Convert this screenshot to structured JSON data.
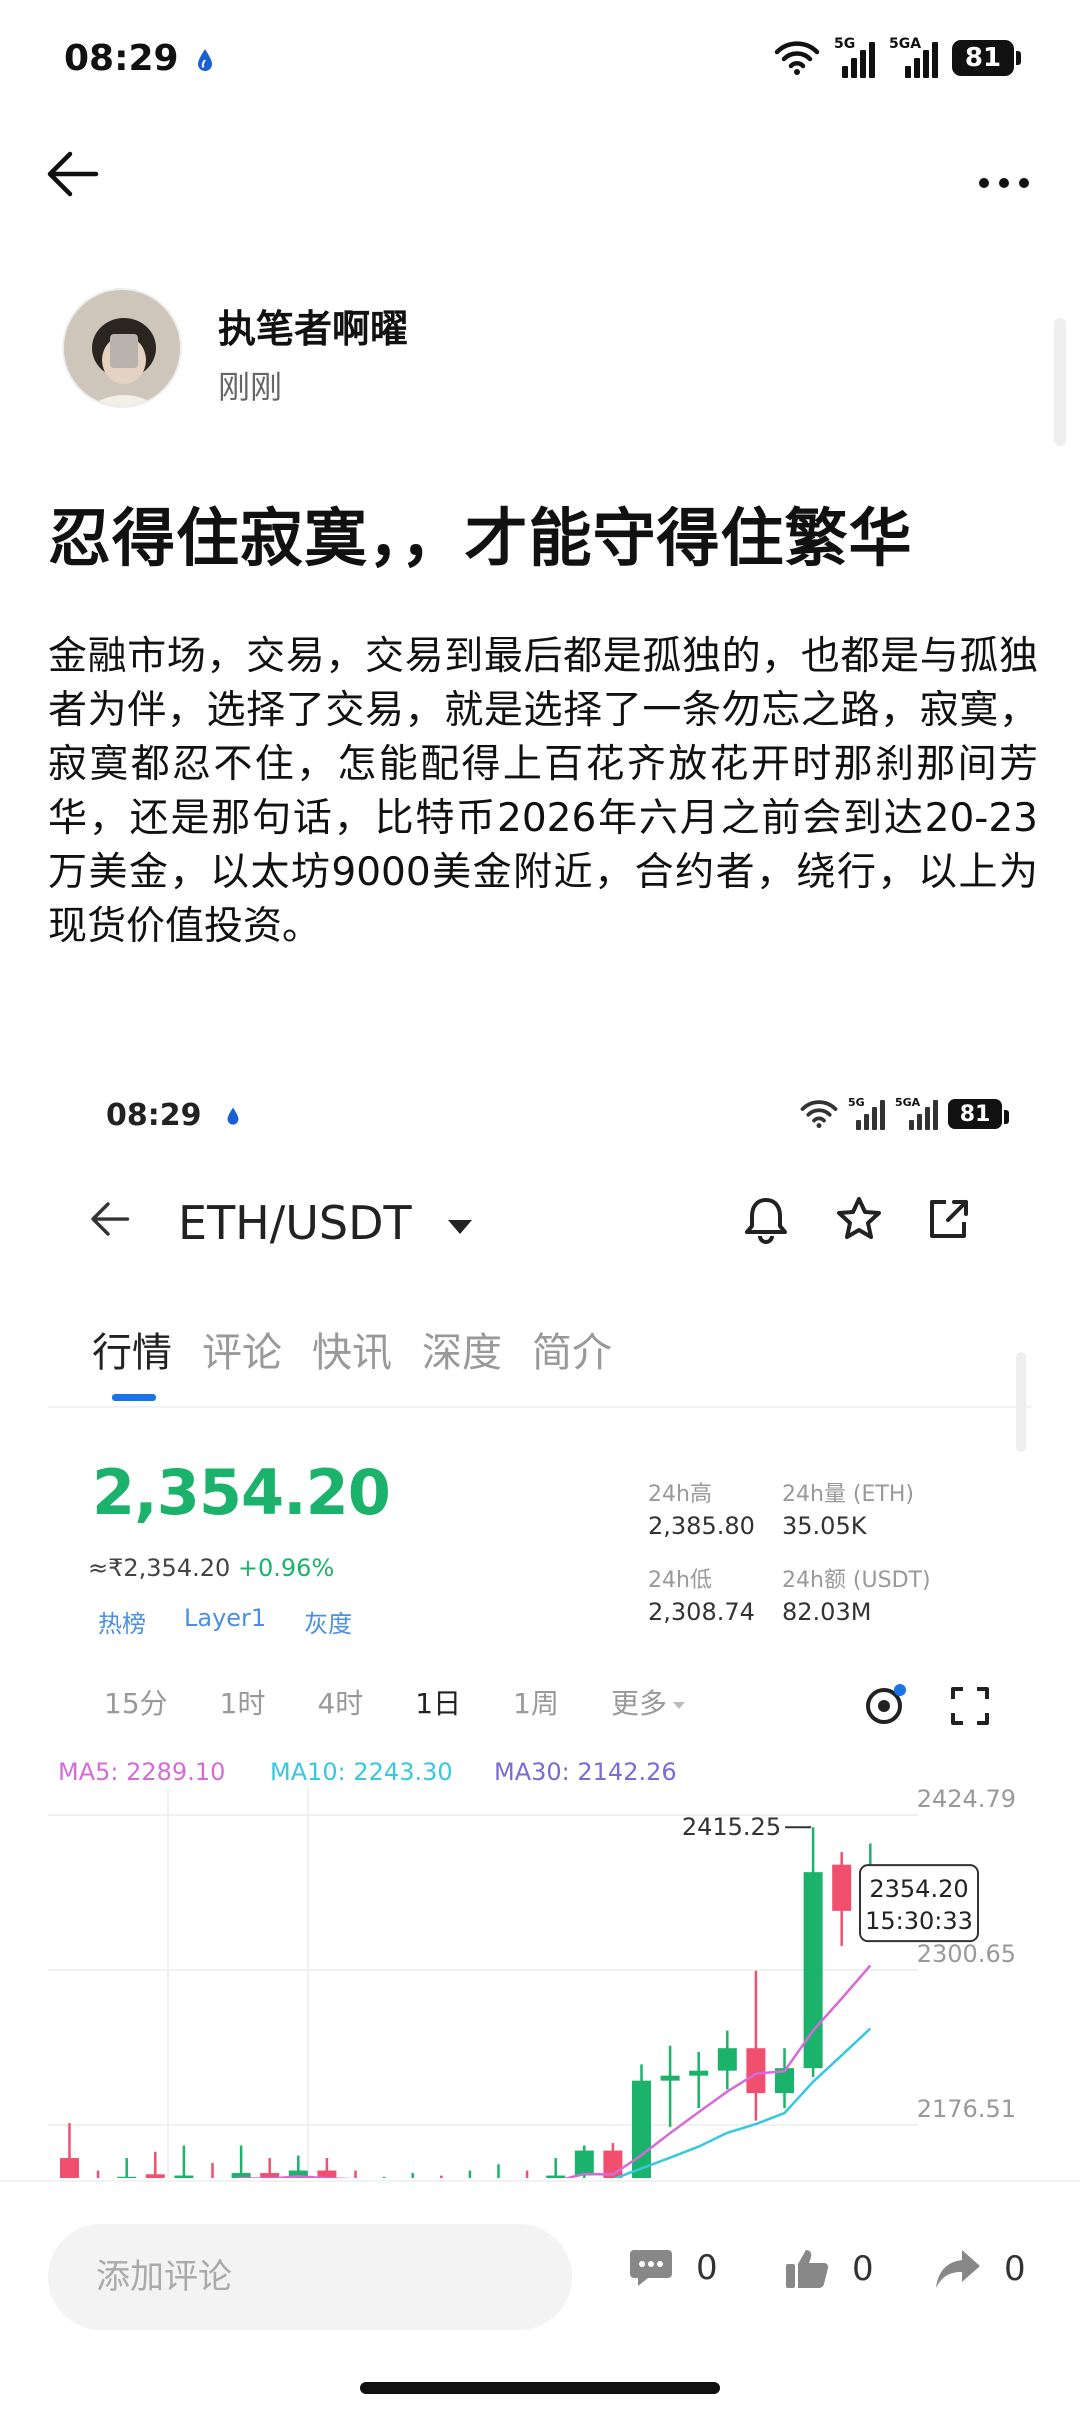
{
  "status_bar": {
    "time": "08:29",
    "net1": "5G",
    "net2": "5GA",
    "battery": "81"
  },
  "author": {
    "name": "执笔者啊曜",
    "time": "刚刚"
  },
  "article": {
    "title": "忍得住寂寞，，才能守得住繁华",
    "body": "金融市场，交易，交易到最后都是孤独的，也都是与孤独者为伴，选择了交易，就是选择了一条勿忘之路，寂寞，寂寞都忍不住，怎能配得上百花齐放花开时那刹那间芳华，还是那句话，比特币2026年六月之前会到达20-23万美金，以太坊9000美金附近，合约者，绕行，以上为现货价值投资。"
  },
  "screenshot": {
    "status": {
      "time": "08:29",
      "net1": "5G",
      "net2": "5GA",
      "battery": "81"
    },
    "pair": "ETH/USDT",
    "tabs": [
      "行情",
      "评论",
      "快讯",
      "深度",
      "简介"
    ],
    "price": "2,354.20",
    "approx": "≈₹2,354.20",
    "change": "+0.96%",
    "tags": [
      "热榜",
      "Layer1",
      "灰度"
    ],
    "stats": {
      "high_label": "24h高",
      "high": "2,385.80",
      "vol_label": "24h量 (ETH)",
      "vol": "35.05K",
      "low_label": "24h低",
      "low": "2,308.74",
      "amt_label": "24h额 (USDT)",
      "amt": "82.03M"
    },
    "periods": [
      "15分",
      "1时",
      "4时",
      "1日",
      "1周",
      "更多"
    ],
    "ma": {
      "ma5": "MA5: 2289.10",
      "ma10": "MA10: 2243.30",
      "ma30": "MA30: 2142.26"
    },
    "colors": {
      "up": "#1bb26b",
      "down": "#f0506e",
      "ma5": "#d66ad9",
      "ma10": "#37c8e0",
      "ma30": "#7a6bd6",
      "accent": "#1a73e8"
    }
  },
  "chart_data": {
    "type": "candlestick",
    "y_ticks": [
      "2424.79",
      "2300.65",
      "2176.51"
    ],
    "high_marker": "2415.25",
    "last_price": "2354.20",
    "last_time": "15:30:33",
    "ylim": [
      2110,
      2440
    ],
    "candles": [
      {
        "o": 2150,
        "c": 2122,
        "h": 2178,
        "l": 2100
      },
      {
        "o": 2130,
        "c": 2124,
        "h": 2140,
        "l": 2110
      },
      {
        "o": 2128,
        "c": 2135,
        "h": 2150,
        "l": 2120
      },
      {
        "o": 2137,
        "c": 2130,
        "h": 2155,
        "l": 2120
      },
      {
        "o": 2132,
        "c": 2136,
        "h": 2160,
        "l": 2125
      },
      {
        "o": 2134,
        "c": 2130,
        "h": 2146,
        "l": 2120
      },
      {
        "o": 2130,
        "c": 2138,
        "h": 2160,
        "l": 2120
      },
      {
        "o": 2138,
        "c": 2133,
        "h": 2150,
        "l": 2125
      },
      {
        "o": 2133,
        "c": 2140,
        "h": 2152,
        "l": 2126
      },
      {
        "o": 2140,
        "c": 2128,
        "h": 2150,
        "l": 2118
      },
      {
        "o": 2128,
        "c": 2126,
        "h": 2140,
        "l": 2115
      },
      {
        "o": 2126,
        "c": 2130,
        "h": 2135,
        "l": 2115
      },
      {
        "o": 2130,
        "c": 2131,
        "h": 2138,
        "l": 2118
      },
      {
        "o": 2131,
        "c": 2128,
        "h": 2136,
        "l": 2115
      },
      {
        "o": 2128,
        "c": 2132,
        "h": 2140,
        "l": 2120
      },
      {
        "o": 2132,
        "c": 2134,
        "h": 2145,
        "l": 2118
      },
      {
        "o": 2134,
        "c": 2128,
        "h": 2140,
        "l": 2116
      },
      {
        "o": 2128,
        "c": 2136,
        "h": 2150,
        "l": 2120
      },
      {
        "o": 2136,
        "c": 2156,
        "h": 2160,
        "l": 2126
      },
      {
        "o": 2156,
        "c": 2130,
        "h": 2162,
        "l": 2120
      },
      {
        "o": 2130,
        "c": 2212,
        "h": 2225,
        "l": 2120
      },
      {
        "o": 2212,
        "c": 2216,
        "h": 2240,
        "l": 2175
      },
      {
        "o": 2216,
        "c": 2220,
        "h": 2235,
        "l": 2190
      },
      {
        "o": 2220,
        "c": 2238,
        "h": 2252,
        "l": 2205
      },
      {
        "o": 2238,
        "c": 2202,
        "h": 2300,
        "l": 2180
      },
      {
        "o": 2202,
        "c": 2222,
        "h": 2238,
        "l": 2190
      },
      {
        "o": 2222,
        "c": 2379,
        "h": 2415,
        "l": 2215
      },
      {
        "o": 2385,
        "c": 2348,
        "h": 2395,
        "l": 2320
      },
      {
        "o": 2345,
        "c": 2370,
        "h": 2402,
        "l": 2338
      }
    ]
  },
  "bottom": {
    "placeholder": "添加评论",
    "comments": "0",
    "likes": "0",
    "shares": "0"
  }
}
